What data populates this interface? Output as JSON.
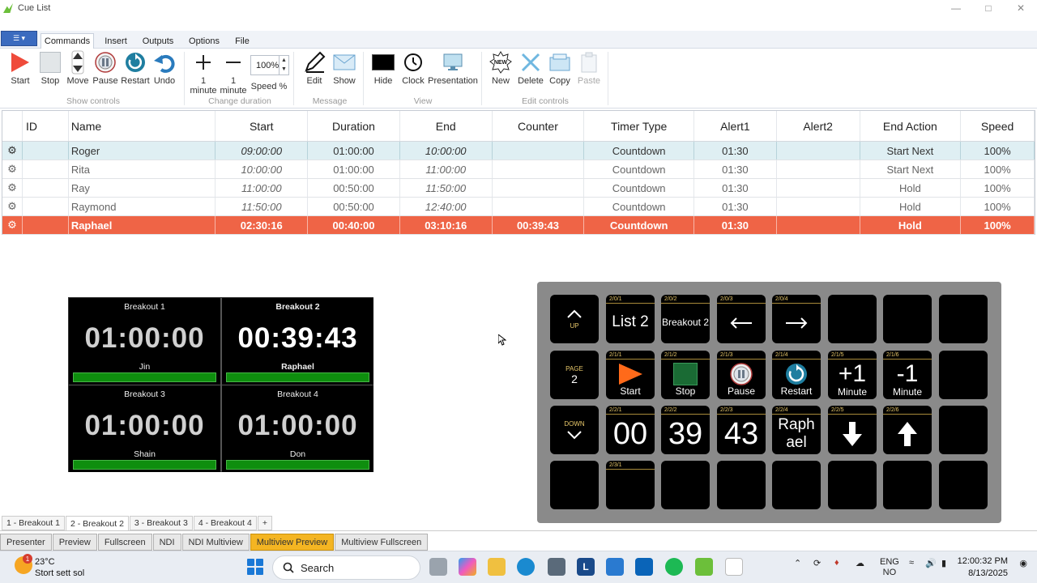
{
  "window": {
    "title": "Cue List"
  },
  "ribbon": {
    "tabs": [
      "Commands",
      "Insert",
      "Outputs",
      "Options",
      "File"
    ],
    "show_controls": {
      "group_label": "Show controls",
      "buttons": [
        "Start",
        "Stop",
        "Move",
        "Pause",
        "Restart",
        "Undo"
      ]
    },
    "change_duration": {
      "group_label": "Change duration",
      "plus_label": "1 minute",
      "minus_label": "1 minute",
      "speed_value": "100%",
      "speed_label": "Speed %"
    },
    "message": {
      "group_label": "Message",
      "buttons": [
        "Edit",
        "Show"
      ]
    },
    "view": {
      "group_label": "View",
      "buttons": [
        "Hide",
        "Clock",
        "Presentation"
      ]
    },
    "edit_controls": {
      "group_label": "Edit controls",
      "buttons": [
        "New",
        "Delete",
        "Copy",
        "Paste"
      ],
      "new_badge": "NEW"
    }
  },
  "grid": {
    "headers": [
      "ID",
      "Name",
      "Start",
      "Duration",
      "End",
      "Counter",
      "Timer Type",
      "Alert1",
      "Alert2",
      "End Action",
      "Speed"
    ],
    "rows": [
      {
        "id": "",
        "name": "Roger",
        "start": "09:00:00",
        "duration": "01:00:00",
        "end": "10:00:00",
        "counter": "",
        "timer_type": "Countdown",
        "alert1": "01:30",
        "alert2": "",
        "end_action": "Start Next",
        "speed": "100%"
      },
      {
        "id": "",
        "name": "Rita",
        "start": "10:00:00",
        "duration": "01:00:00",
        "end": "11:00:00",
        "counter": "",
        "timer_type": "Countdown",
        "alert1": "01:30",
        "alert2": "",
        "end_action": "Start Next",
        "speed": "100%"
      },
      {
        "id": "",
        "name": "Ray",
        "start": "11:00:00",
        "duration": "00:50:00",
        "end": "11:50:00",
        "counter": "",
        "timer_type": "Countdown",
        "alert1": "01:30",
        "alert2": "",
        "end_action": "Hold",
        "speed": "100%"
      },
      {
        "id": "",
        "name": "Raymond",
        "start": "11:50:00",
        "duration": "00:50:00",
        "end": "12:40:00",
        "counter": "",
        "timer_type": "Countdown",
        "alert1": "01:30",
        "alert2": "",
        "end_action": "Hold",
        "speed": "100%"
      },
      {
        "id": "",
        "name": "Raphael",
        "start": "02:30:16",
        "duration": "00:40:00",
        "end": "03:10:16",
        "counter": "00:39:43",
        "timer_type": "Countdown",
        "alert1": "01:30",
        "alert2": "",
        "end_action": "Hold",
        "speed": "100%"
      }
    ]
  },
  "multiview": [
    {
      "title": "Breakout 1",
      "time": "01:00:00",
      "name": "Jin",
      "progress": 1.0
    },
    {
      "title": "Breakout 2",
      "time": "00:39:43",
      "name": "Raphael",
      "progress": 1.0
    },
    {
      "title": "Breakout 3",
      "time": "01:00:00",
      "name": "Shain",
      "progress": 1.0
    },
    {
      "title": "Breakout 4",
      "time": "01:00:00",
      "name": "Don",
      "progress": 1.0
    }
  ],
  "streamdeck": {
    "nav": {
      "up": "UP",
      "page_label": "PAGE",
      "page": "2",
      "down": "DOWN"
    },
    "row1": [
      {
        "tag": "2/0/1",
        "text": "List 2"
      },
      {
        "tag": "2/0/2",
        "text": "Breakout 2"
      },
      {
        "tag": "2/0/3",
        "icon": "left-arrow"
      },
      {
        "tag": "2/0/4",
        "icon": "right-arrow"
      }
    ],
    "row2": [
      {
        "tag": "2/1/1",
        "label": "Start"
      },
      {
        "tag": "2/1/2",
        "label": "Stop"
      },
      {
        "tag": "2/1/3",
        "label": "Pause"
      },
      {
        "tag": "2/1/4",
        "label": "Restart"
      },
      {
        "tag": "2/1/5",
        "big": "+1",
        "label": "Minute"
      },
      {
        "tag": "2/1/6",
        "big": "-1",
        "label": "Minute"
      }
    ],
    "row3": [
      {
        "tag": "2/2/1",
        "text": "00"
      },
      {
        "tag": "2/2/2",
        "text": "39"
      },
      {
        "tag": "2/2/3",
        "text": "43"
      },
      {
        "tag": "2/2/4",
        "line1": "Raph",
        "line2": "ael"
      },
      {
        "tag": "2/2/5",
        "icon": "down-arrow"
      },
      {
        "tag": "2/2/6",
        "icon": "up-arrow"
      }
    ],
    "row4": [
      {
        "tag": "2/3/1"
      }
    ]
  },
  "breakout_tabs": [
    "1 - Breakout 1",
    "2 - Breakout 2",
    "3 - Breakout 3",
    "4 - Breakout 4",
    "+"
  ],
  "output_tabs": [
    "Presenter",
    "Preview",
    "Fullscreen",
    "NDI",
    "NDI Multiview",
    "Multiview Preview",
    "Multiview Fullscreen"
  ],
  "taskbar": {
    "weather_temp": "23°C",
    "weather_desc": "Stort sett sol",
    "weather_badge": "1",
    "search": "Search",
    "lang1": "ENG",
    "lang2": "NO",
    "time": "12:00:32 PM",
    "date": "8/13/2025"
  },
  "colors": {
    "live_row": "#ef6446",
    "selected_row": "#dfeff3",
    "progress_green": "#0e8e0e",
    "active_output_tab": "#f4b522"
  }
}
